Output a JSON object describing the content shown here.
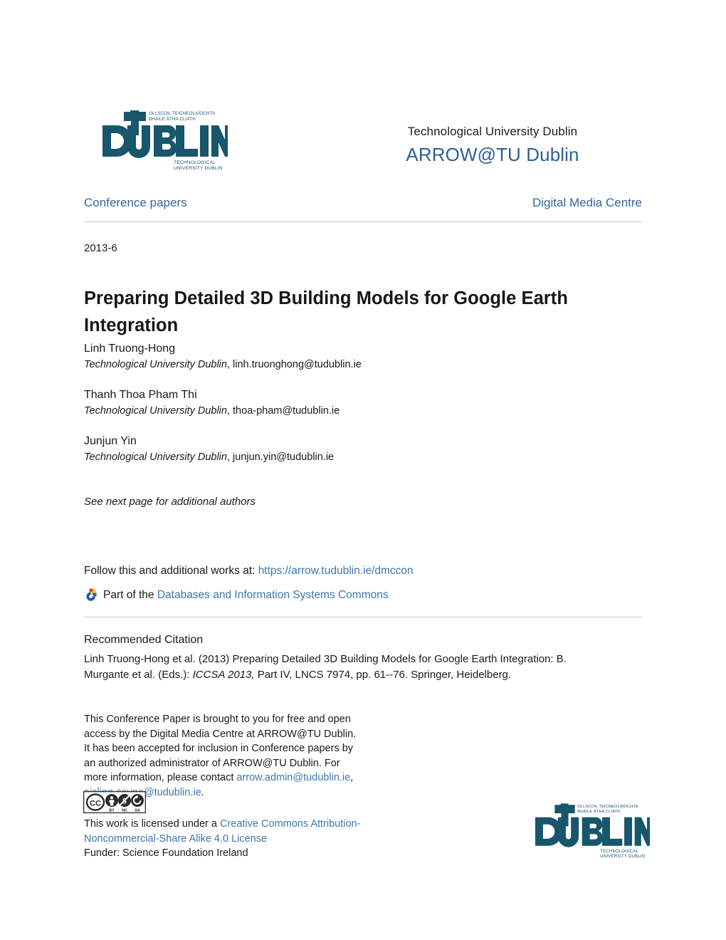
{
  "header": {
    "logo": {
      "icon": "tu-dublin-logo",
      "wordmark": "DUBLIN",
      "t_letter": "T",
      "u_letter": "U",
      "irish_line1": "OLLSCOIL TEICNEOLAÍOCHTA",
      "irish_line2": "BHAILE ÁTHA CLIATH",
      "sub_line1": "TECHNOLOGICAL",
      "sub_line2": "UNIVERSITY DUBLIN",
      "color": "#17566b"
    },
    "institution": "Technological University Dublin",
    "repository": "ARROW@TU Dublin",
    "repository_color": "#2e6094"
  },
  "nav": {
    "left_label": "Conference papers",
    "right_label": "Digital Media Centre",
    "link_color": "#34669b"
  },
  "record": {
    "date": "2013-6",
    "title": "Preparing Detailed 3D Building Models for Google Earth Integration",
    "authors": [
      {
        "name": "Linh Truong-Hong",
        "affiliation": "Technological University Dublin",
        "email": "linh.truonghong@tudublin.ie"
      },
      {
        "name": "Thanh Thoa Pham Thi",
        "affiliation": "Technological University Dublin",
        "email": "thoa-pham@tudublin.ie"
      },
      {
        "name": "Junjun Yin",
        "affiliation": "Technological University Dublin",
        "email": "junjun.yin@tudublin.ie"
      }
    ],
    "additional_authors_note": "See next page for additional authors"
  },
  "follow": {
    "prefix": "Follow this and additional works at:",
    "url": "https://arrow.tudublin.ie/dmccon",
    "part_of_prefix": "Part of the",
    "commons_link": "Databases and Information Systems Commons",
    "commons_icon": "digital-commons-network-icon"
  },
  "citation": {
    "heading": "Recommended Citation",
    "text_part1": "Linh Truong-Hong et al. (2013) Preparing Detailed 3D Building Models for Google Earth Integration: B. Murgante et al. (Eds.): ",
    "italic_part": "ICCSA 2013,",
    "text_part2": " Part IV, LNCS 7974, pp. 61--76. Springer, Heidelberg."
  },
  "notice": {
    "body_before_links": "This Conference Paper is brought to you for free and open access by the Digital Media Centre at ARROW@TU Dublin. It has been accepted for inclusion in Conference papers by an authorized administrator of ARROW@TU Dublin. For more information, please contact ",
    "contact_email_1": "arrow.admin@tudublin.ie",
    "contact_separator": ", ",
    "contact_email_2": "aisling.coyne@tudublin.ie",
    "body_after_links": "."
  },
  "license": {
    "badge_icon": "creative-commons-by-nc-sa-badge",
    "badge_cc": "CC",
    "badge_by": "BY",
    "badge_nc": "NC",
    "badge_sa": "SA",
    "prefix": "This work is licensed under a ",
    "link_text": "Creative Commons Attribution-Noncommercial-Share Alike 4.0 License",
    "funder": "Funder: Science Foundation Ireland"
  }
}
